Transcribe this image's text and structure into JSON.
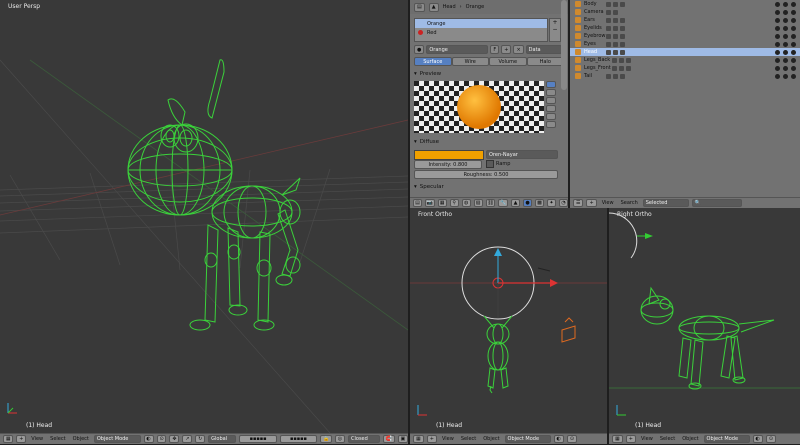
{
  "left_view": {
    "label": "User Persp",
    "object_label": "(1) Head",
    "header": {
      "menus": [
        "View",
        "Select",
        "Object"
      ],
      "mode": "Object Mode",
      "orientation": "Global",
      "proportional": "Closed"
    }
  },
  "front_view": {
    "label": "Front Ortho",
    "object_label": "(1) Head",
    "header": {
      "menus": [
        "View",
        "Select",
        "Object"
      ],
      "mode": "Object Mode"
    }
  },
  "right_view": {
    "label": "Right Ortho",
    "object_label": "(1) Head",
    "header": {
      "menus": [
        "View",
        "Select",
        "Object"
      ],
      "mode": "Object Mode"
    }
  },
  "properties": {
    "breadcrumb": [
      "Head",
      "Orange"
    ],
    "material_slots": [
      "Orange",
      "Red"
    ],
    "selected_material": "Orange",
    "data_dropdown": "Data",
    "tabs": [
      "Surface",
      "Wire",
      "Volume",
      "Halo"
    ],
    "active_tab": "Surface",
    "preview_label": "Preview",
    "diffuse_label": "Diffuse",
    "diffuse_shader": "Oren-Nayar",
    "diffuse_color": "#f0a000",
    "intensity": "Intensity: 0.800",
    "ramp_label": "Ramp",
    "roughness": "Roughness: 0.500",
    "specular_label": "Specular"
  },
  "outliner": {
    "items": [
      "Body",
      "Camera",
      "Ears",
      "Eyelids",
      "Eyebrow",
      "Eyes",
      "Head",
      "Legs_Back",
      "Legs_Front",
      "Tail"
    ],
    "selected": "Head",
    "footer": {
      "view": "View",
      "search_label": "Search",
      "search_value": "Selected"
    }
  },
  "colors": {
    "wire": "#3bd13b",
    "viewport_bg": "#393939",
    "panel_bg": "#727272",
    "selected_row": "#9fbbe6"
  }
}
